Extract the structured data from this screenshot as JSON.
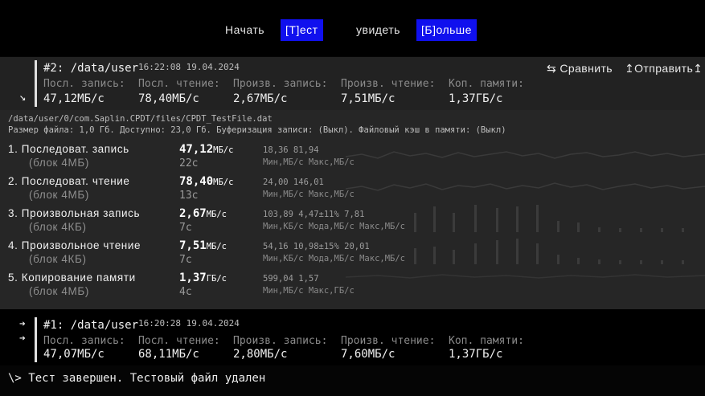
{
  "menu": {
    "items": [
      {
        "label": "Начать",
        "selected": false
      },
      {
        "label": "[Т]ест",
        "selected": true
      },
      {
        "label": "увидеть",
        "selected": false
      },
      {
        "label": "[Б]ольше",
        "selected": true
      }
    ]
  },
  "run2": {
    "expand_glyph": "↘",
    "title": "#2: /data/user",
    "time": "16:22:08 19.04.2024",
    "compare_label": "⇆ Сравнить",
    "send_label": "↥Отправить↥",
    "metrics": [
      {
        "label": "Посл. запись:",
        "value": "47,12МБ/с"
      },
      {
        "label": "Посл. чтение:",
        "value": "78,40МБ/с"
      },
      {
        "label": "Произв. запись:",
        "value": "2,67МБ/с"
      },
      {
        "label": "Произв. чтение:",
        "value": "7,51МБ/с"
      },
      {
        "label": "Коп. памяти:",
        "value": "1,37ГБ/с"
      }
    ]
  },
  "details": {
    "path": "/data/user/0/com.Saplin.CPDT/files/CPDT_TestFile.dat",
    "info": "Размер файла: 1,0 Гб. Доступно: 23,0 Гб. Буферизация записи: (Выкл). Файловый кэш в памяти: (Выкл)",
    "tests": [
      {
        "name": "1. Последоват. запись",
        "block": "(блок 4МБ)",
        "value": "47,12",
        "unit": "МБ/с",
        "duration": "22с",
        "stats": "18,36   81,94",
        "stats_labels": "Мин,МБ/с Макс,МБ/с"
      },
      {
        "name": "2. Последоват. чтение",
        "block": "(блок 4МБ)",
        "value": "78,40",
        "unit": "МБ/с",
        "duration": "13с",
        "stats": "24,00   146,01",
        "stats_labels": "Мин,МБ/с Макс,МБ/с"
      },
      {
        "name": "3. Произвольная запись",
        "block": "(блок 4КБ)",
        "value": "2,67",
        "unit": "МБ/с",
        "duration": "7с",
        "stats": "103,89  4,47±11%  7,81",
        "stats_labels": "Мин,КБ/с Мода,МБ/с Макс,МБ/с"
      },
      {
        "name": "4. Произвольное чтение",
        "block": "(блок 4КБ)",
        "value": "7,51",
        "unit": "МБ/с",
        "duration": "7с",
        "stats": "54,16   10,98±15% 20,01",
        "stats_labels": "Мин,КБ/с Мода,МБ/с Макс,МБ/с"
      },
      {
        "name": "5. Копирование памяти",
        "block": "(блок 4МБ)",
        "value": "1,37",
        "unit": "ГБ/с",
        "duration": "4с",
        "stats": "599,04  1,57",
        "stats_labels": "Мин,МБ/с Макс,ГБ/с"
      }
    ]
  },
  "run1": {
    "arrow1": "➔",
    "arrow2": "➔",
    "title": "#1: /data/user",
    "time": "16:20:28 19.04.2024",
    "metrics": [
      {
        "label": "Посл. запись:",
        "value": "47,07МБ/с"
      },
      {
        "label": "Посл. чтение:",
        "value": "68,11МБ/с"
      },
      {
        "label": "Произв. запись:",
        "value": "2,80МБ/с"
      },
      {
        "label": "Произв. чтение:",
        "value": "7,60МБ/с"
      },
      {
        "label": "Коп. памяти:",
        "value": "1,37ГБ/с"
      }
    ]
  },
  "status": "\\> Тест завершен. Тестовый файл удален",
  "colors": {
    "accent": "#1010ee",
    "background": "#050505",
    "panel": "#262626"
  }
}
